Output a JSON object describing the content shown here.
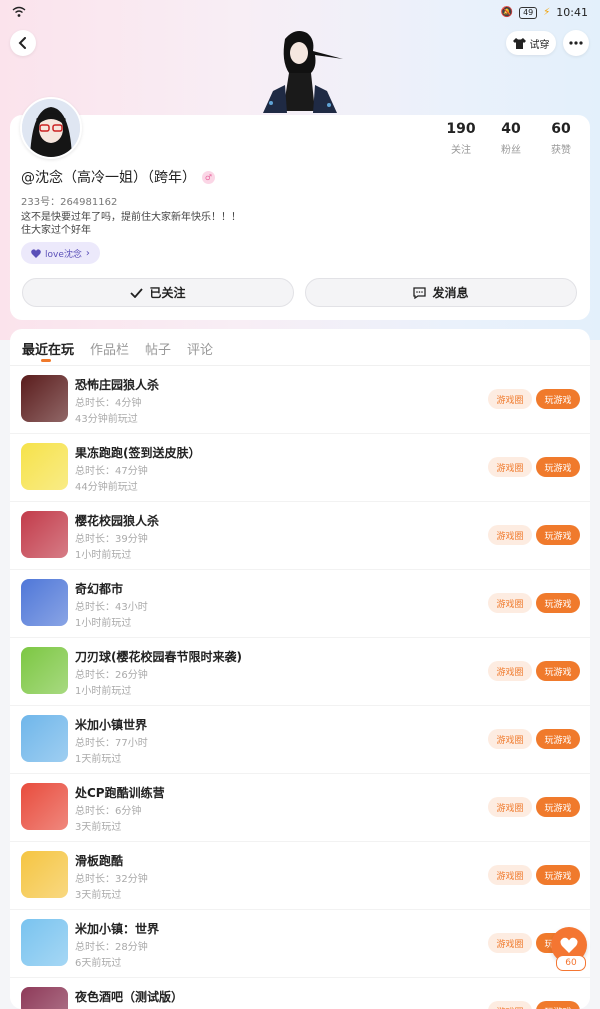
{
  "status_bar": {
    "time": "10:41",
    "battery": "49"
  },
  "header": {
    "tryon_label": "试穿"
  },
  "profile": {
    "stats": [
      {
        "value": "190",
        "label": "关注"
      },
      {
        "value": "40",
        "label": "粉丝"
      },
      {
        "value": "60",
        "label": "获赞"
      }
    ],
    "name": "@沈念（高冷一姐）（跨年）",
    "uid": "233号：264981162",
    "bio_line1": "这不是快要过年了吗，提前住大家新年快乐！！！",
    "bio_line2": "住大家过个好年",
    "tag": "love沈念",
    "follow_label": "已关注",
    "message_label": "发消息"
  },
  "tabs": [
    "最近在玩",
    "作品栏",
    "帖子",
    "评论"
  ],
  "game_buttons": {
    "circle": "游戏圈",
    "play": "玩游戏"
  },
  "games": [
    {
      "title": "恐怖庄园狼人杀",
      "duration": "总时长：4分钟",
      "last_played": "43分钟前玩过",
      "icon_color": "#5a1c1c"
    },
    {
      "title": "果冻跑跑(签到送皮肤）",
      "duration": "总时长：47分钟",
      "last_played": "44分钟前玩过",
      "icon_color": "#f6e24a"
    },
    {
      "title": "樱花校园狼人杀",
      "duration": "总时长：39分钟",
      "last_played": "1小时前玩过",
      "icon_color": "#c23b4a"
    },
    {
      "title": "奇幻都市",
      "duration": "总时长：43小时",
      "last_played": "1小时前玩过",
      "icon_color": "#4f77d8"
    },
    {
      "title": "刀刃球(樱花校园春节限时来袭)",
      "duration": "总时长：26分钟",
      "last_played": "1小时前玩过",
      "icon_color": "#7cc742"
    },
    {
      "title": "米加小镇世界",
      "duration": "总时长：77小时",
      "last_played": "1天前玩过",
      "icon_color": "#6fb6ea"
    },
    {
      "title": "处CP跑酷训练营",
      "duration": "总时长：6分钟",
      "last_played": "3天前玩过",
      "icon_color": "#e84c3d"
    },
    {
      "title": "滑板跑酷",
      "duration": "总时长：32分钟",
      "last_played": "3天前玩过",
      "icon_color": "#f5c542"
    },
    {
      "title": "米加小镇：世界",
      "duration": "总时长：28分钟",
      "last_played": "6天前玩过",
      "icon_color": "#79c3ef"
    },
    {
      "title": "夜色酒吧（测试版）",
      "duration": "",
      "last_played": "",
      "icon_color": "#8e3a59"
    }
  ],
  "float": {
    "count": "60"
  },
  "colors": {
    "accent": "#f07a2c",
    "tag_bg": "#ece9fb"
  }
}
